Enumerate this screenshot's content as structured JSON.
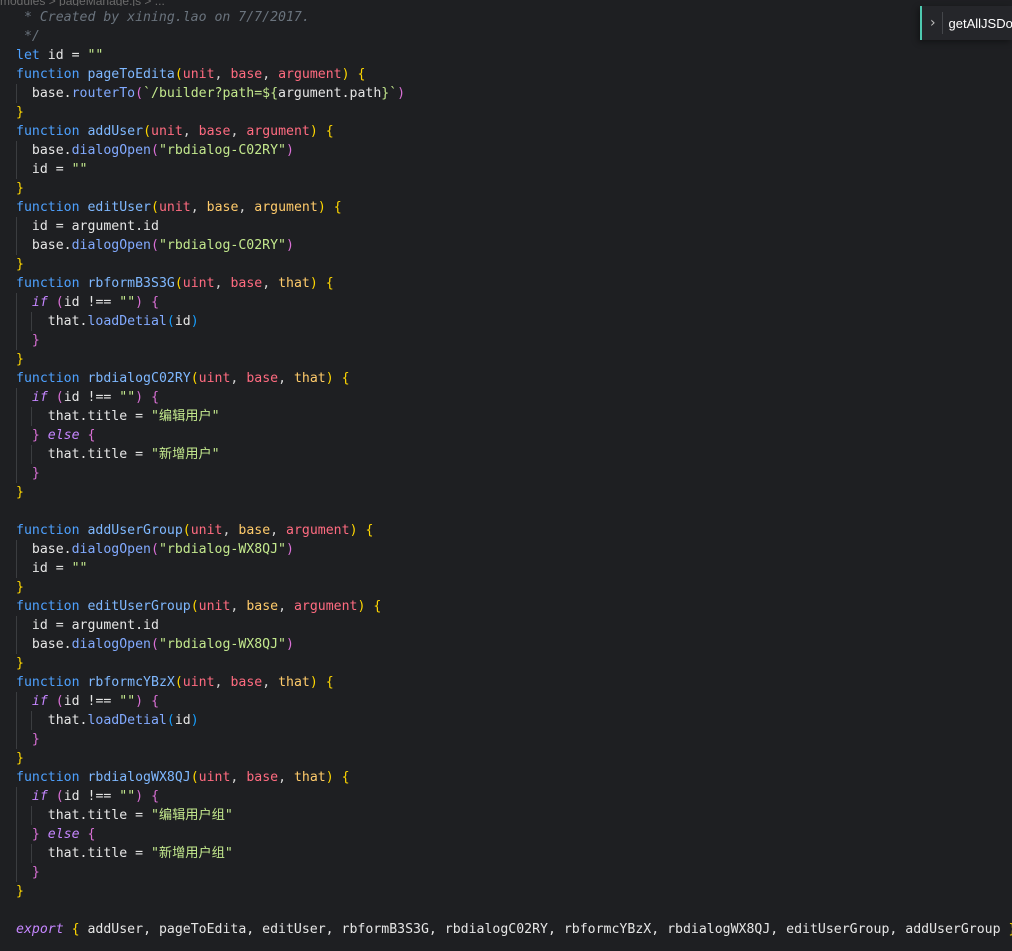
{
  "breadcrumb": {
    "text": "modules  >  pageManage.js  >  ..."
  },
  "outline": {
    "label": "getAllJSDoc"
  },
  "colors": {
    "background": "#1e1f22",
    "keyword": "#4ea1ff",
    "function_name": "#7fb8ff",
    "parameter": "#ff6b80",
    "string": "#c3e88d",
    "comment": "#6a737d",
    "control": "#c586ff"
  },
  "code": {
    "lines": [
      [
        {
          "t": " * Created by xining.lao on 7/7/2017.",
          "c": "comment"
        }
      ],
      [
        {
          "t": " */",
          "c": "comment"
        }
      ],
      [
        {
          "t": "let",
          "c": "keyword"
        },
        {
          "t": " id = ",
          "c": "var"
        },
        {
          "t": "\"\"",
          "c": "string"
        }
      ],
      [
        {
          "t": "function",
          "c": "keyword"
        },
        {
          "t": " ",
          "c": "var"
        },
        {
          "t": "pageToEdita",
          "c": "fn"
        },
        {
          "t": "(",
          "c": "b1"
        },
        {
          "t": "unit",
          "c": "param"
        },
        {
          "t": ", ",
          "c": "punc"
        },
        {
          "t": "base",
          "c": "param"
        },
        {
          "t": ", ",
          "c": "punc"
        },
        {
          "t": "argument",
          "c": "param"
        },
        {
          "t": ")",
          "c": "b1"
        },
        {
          "t": " ",
          "c": "punc"
        },
        {
          "t": "{",
          "c": "b1"
        }
      ],
      [
        {
          "t": "  base.",
          "c": "var"
        },
        {
          "t": "routerTo",
          "c": "method"
        },
        {
          "t": "(",
          "c": "b2"
        },
        {
          "t": "`/builder?path=${",
          "c": "string"
        },
        {
          "t": "argument.path",
          "c": "var"
        },
        {
          "t": "}`",
          "c": "string"
        },
        {
          "t": ")",
          "c": "b2"
        }
      ],
      [
        {
          "t": "}",
          "c": "b1"
        }
      ],
      [
        {
          "t": "function",
          "c": "keyword"
        },
        {
          "t": " ",
          "c": "var"
        },
        {
          "t": "addUser",
          "c": "fn"
        },
        {
          "t": "(",
          "c": "b1"
        },
        {
          "t": "unit",
          "c": "param"
        },
        {
          "t": ", ",
          "c": "punc"
        },
        {
          "t": "base",
          "c": "param"
        },
        {
          "t": ", ",
          "c": "punc"
        },
        {
          "t": "argument",
          "c": "param"
        },
        {
          "t": ")",
          "c": "b1"
        },
        {
          "t": " ",
          "c": "punc"
        },
        {
          "t": "{",
          "c": "b1"
        }
      ],
      [
        {
          "t": "  base.",
          "c": "var"
        },
        {
          "t": "dialogOpen",
          "c": "method"
        },
        {
          "t": "(",
          "c": "b2"
        },
        {
          "t": "\"rbdialog-C02RY\"",
          "c": "string"
        },
        {
          "t": ")",
          "c": "b2"
        }
      ],
      [
        {
          "t": "  id = ",
          "c": "var"
        },
        {
          "t": "\"\"",
          "c": "string"
        }
      ],
      [
        {
          "t": "}",
          "c": "b1"
        }
      ],
      [
        {
          "t": "function",
          "c": "keyword"
        },
        {
          "t": " ",
          "c": "var"
        },
        {
          "t": "editUser",
          "c": "fn"
        },
        {
          "t": "(",
          "c": "b1"
        },
        {
          "t": "unit",
          "c": "param"
        },
        {
          "t": ", ",
          "c": "punc"
        },
        {
          "t": "base",
          "c": "param-y"
        },
        {
          "t": ", ",
          "c": "punc"
        },
        {
          "t": "argument",
          "c": "param-y"
        },
        {
          "t": ")",
          "c": "b1"
        },
        {
          "t": " ",
          "c": "punc"
        },
        {
          "t": "{",
          "c": "b1"
        }
      ],
      [
        {
          "t": "  id = argument.id",
          "c": "var"
        }
      ],
      [
        {
          "t": "  base.",
          "c": "var"
        },
        {
          "t": "dialogOpen",
          "c": "method"
        },
        {
          "t": "(",
          "c": "b2"
        },
        {
          "t": "\"rbdialog-C02RY\"",
          "c": "string"
        },
        {
          "t": ")",
          "c": "b2"
        }
      ],
      [
        {
          "t": "}",
          "c": "b1"
        }
      ],
      [
        {
          "t": "function",
          "c": "keyword"
        },
        {
          "t": " ",
          "c": "var"
        },
        {
          "t": "rbformB3S3G",
          "c": "fn"
        },
        {
          "t": "(",
          "c": "b1"
        },
        {
          "t": "uint",
          "c": "param"
        },
        {
          "t": ", ",
          "c": "punc"
        },
        {
          "t": "base",
          "c": "param"
        },
        {
          "t": ", ",
          "c": "punc"
        },
        {
          "t": "that",
          "c": "param-y"
        },
        {
          "t": ")",
          "c": "b1"
        },
        {
          "t": " ",
          "c": "punc"
        },
        {
          "t": "{",
          "c": "b1"
        }
      ],
      [
        {
          "t": "  ",
          "c": "var"
        },
        {
          "t": "if",
          "c": "ctrl"
        },
        {
          "t": " ",
          "c": "var"
        },
        {
          "t": "(",
          "c": "b2"
        },
        {
          "t": "id !== ",
          "c": "var"
        },
        {
          "t": "\"\"",
          "c": "string"
        },
        {
          "t": ")",
          "c": "b2"
        },
        {
          "t": " ",
          "c": "var"
        },
        {
          "t": "{",
          "c": "b2"
        }
      ],
      [
        {
          "t": "    that.",
          "c": "var"
        },
        {
          "t": "loadDetial",
          "c": "method"
        },
        {
          "t": "(",
          "c": "b3"
        },
        {
          "t": "id",
          "c": "var"
        },
        {
          "t": ")",
          "c": "b3"
        }
      ],
      [
        {
          "t": "  ",
          "c": "var"
        },
        {
          "t": "}",
          "c": "b2"
        }
      ],
      [
        {
          "t": "}",
          "c": "b1"
        }
      ],
      [
        {
          "t": "function",
          "c": "keyword"
        },
        {
          "t": " ",
          "c": "var"
        },
        {
          "t": "rbdialogC02RY",
          "c": "fn"
        },
        {
          "t": "(",
          "c": "b1"
        },
        {
          "t": "uint",
          "c": "param"
        },
        {
          "t": ", ",
          "c": "punc"
        },
        {
          "t": "base",
          "c": "param"
        },
        {
          "t": ", ",
          "c": "punc"
        },
        {
          "t": "that",
          "c": "param-y"
        },
        {
          "t": ")",
          "c": "b1"
        },
        {
          "t": " ",
          "c": "punc"
        },
        {
          "t": "{",
          "c": "b1"
        }
      ],
      [
        {
          "t": "  ",
          "c": "var"
        },
        {
          "t": "if",
          "c": "ctrl"
        },
        {
          "t": " ",
          "c": "var"
        },
        {
          "t": "(",
          "c": "b2"
        },
        {
          "t": "id !== ",
          "c": "var"
        },
        {
          "t": "\"\"",
          "c": "string"
        },
        {
          "t": ")",
          "c": "b2"
        },
        {
          "t": " ",
          "c": "var"
        },
        {
          "t": "{",
          "c": "b2"
        }
      ],
      [
        {
          "t": "    that.title = ",
          "c": "var"
        },
        {
          "t": "\"编辑用户\"",
          "c": "string"
        }
      ],
      [
        {
          "t": "  ",
          "c": "var"
        },
        {
          "t": "}",
          "c": "b2"
        },
        {
          "t": " ",
          "c": "var"
        },
        {
          "t": "else",
          "c": "ctrl"
        },
        {
          "t": " ",
          "c": "var"
        },
        {
          "t": "{",
          "c": "b2"
        }
      ],
      [
        {
          "t": "    that.title = ",
          "c": "var"
        },
        {
          "t": "\"新增用户\"",
          "c": "string"
        }
      ],
      [
        {
          "t": "  ",
          "c": "var"
        },
        {
          "t": "}",
          "c": "b2"
        }
      ],
      [
        {
          "t": "}",
          "c": "b1"
        }
      ],
      [],
      [
        {
          "t": "function",
          "c": "keyword"
        },
        {
          "t": " ",
          "c": "var"
        },
        {
          "t": "addUserGroup",
          "c": "fn"
        },
        {
          "t": "(",
          "c": "b1"
        },
        {
          "t": "unit",
          "c": "param"
        },
        {
          "t": ", ",
          "c": "punc"
        },
        {
          "t": "base",
          "c": "param-y"
        },
        {
          "t": ", ",
          "c": "punc"
        },
        {
          "t": "argument",
          "c": "param"
        },
        {
          "t": ")",
          "c": "b1"
        },
        {
          "t": " ",
          "c": "punc"
        },
        {
          "t": "{",
          "c": "b1"
        }
      ],
      [
        {
          "t": "  base.",
          "c": "var"
        },
        {
          "t": "dialogOpen",
          "c": "method"
        },
        {
          "t": "(",
          "c": "b2"
        },
        {
          "t": "\"rbdialog-WX8QJ\"",
          "c": "string"
        },
        {
          "t": ")",
          "c": "b2"
        }
      ],
      [
        {
          "t": "  id = ",
          "c": "var"
        },
        {
          "t": "\"\"",
          "c": "string"
        }
      ],
      [
        {
          "t": "}",
          "c": "b1"
        }
      ],
      [
        {
          "t": "function",
          "c": "keyword"
        },
        {
          "t": " ",
          "c": "var"
        },
        {
          "t": "editUserGroup",
          "c": "fn"
        },
        {
          "t": "(",
          "c": "b1"
        },
        {
          "t": "unit",
          "c": "param"
        },
        {
          "t": ", ",
          "c": "punc"
        },
        {
          "t": "base",
          "c": "param-y"
        },
        {
          "t": ", ",
          "c": "punc"
        },
        {
          "t": "argument",
          "c": "param"
        },
        {
          "t": ")",
          "c": "b1"
        },
        {
          "t": " ",
          "c": "punc"
        },
        {
          "t": "{",
          "c": "b1"
        }
      ],
      [
        {
          "t": "  id = argument.id",
          "c": "var"
        }
      ],
      [
        {
          "t": "  base.",
          "c": "var"
        },
        {
          "t": "dialogOpen",
          "c": "method"
        },
        {
          "t": "(",
          "c": "b2"
        },
        {
          "t": "\"rbdialog-WX8QJ\"",
          "c": "string"
        },
        {
          "t": ")",
          "c": "b2"
        }
      ],
      [
        {
          "t": "}",
          "c": "b1"
        }
      ],
      [
        {
          "t": "function",
          "c": "keyword"
        },
        {
          "t": " ",
          "c": "var"
        },
        {
          "t": "rbformcYBzX",
          "c": "fn"
        },
        {
          "t": "(",
          "c": "b1"
        },
        {
          "t": "uint",
          "c": "param"
        },
        {
          "t": ", ",
          "c": "punc"
        },
        {
          "t": "base",
          "c": "param"
        },
        {
          "t": ", ",
          "c": "punc"
        },
        {
          "t": "that",
          "c": "param-y"
        },
        {
          "t": ")",
          "c": "b1"
        },
        {
          "t": " ",
          "c": "punc"
        },
        {
          "t": "{",
          "c": "b1"
        }
      ],
      [
        {
          "t": "  ",
          "c": "var"
        },
        {
          "t": "if",
          "c": "ctrl"
        },
        {
          "t": " ",
          "c": "var"
        },
        {
          "t": "(",
          "c": "b2"
        },
        {
          "t": "id !== ",
          "c": "var"
        },
        {
          "t": "\"\"",
          "c": "string"
        },
        {
          "t": ")",
          "c": "b2"
        },
        {
          "t": " ",
          "c": "var"
        },
        {
          "t": "{",
          "c": "b2"
        }
      ],
      [
        {
          "t": "    that.",
          "c": "var"
        },
        {
          "t": "loadDetial",
          "c": "method"
        },
        {
          "t": "(",
          "c": "b3"
        },
        {
          "t": "id",
          "c": "var"
        },
        {
          "t": ")",
          "c": "b3"
        }
      ],
      [
        {
          "t": "  ",
          "c": "var"
        },
        {
          "t": "}",
          "c": "b2"
        }
      ],
      [
        {
          "t": "}",
          "c": "b1"
        }
      ],
      [
        {
          "t": "function",
          "c": "keyword"
        },
        {
          "t": " ",
          "c": "var"
        },
        {
          "t": "rbdialogWX8QJ",
          "c": "fn"
        },
        {
          "t": "(",
          "c": "b1"
        },
        {
          "t": "uint",
          "c": "param"
        },
        {
          "t": ", ",
          "c": "punc"
        },
        {
          "t": "base",
          "c": "param"
        },
        {
          "t": ", ",
          "c": "punc"
        },
        {
          "t": "that",
          "c": "param-y"
        },
        {
          "t": ")",
          "c": "b1"
        },
        {
          "t": " ",
          "c": "punc"
        },
        {
          "t": "{",
          "c": "b1"
        }
      ],
      [
        {
          "t": "  ",
          "c": "var"
        },
        {
          "t": "if",
          "c": "ctrl"
        },
        {
          "t": " ",
          "c": "var"
        },
        {
          "t": "(",
          "c": "b2"
        },
        {
          "t": "id !== ",
          "c": "var"
        },
        {
          "t": "\"\"",
          "c": "string"
        },
        {
          "t": ")",
          "c": "b2"
        },
        {
          "t": " ",
          "c": "var"
        },
        {
          "t": "{",
          "c": "b2"
        }
      ],
      [
        {
          "t": "    that.title = ",
          "c": "var"
        },
        {
          "t": "\"编辑用户组\"",
          "c": "string"
        }
      ],
      [
        {
          "t": "  ",
          "c": "var"
        },
        {
          "t": "}",
          "c": "b2"
        },
        {
          "t": " ",
          "c": "var"
        },
        {
          "t": "else",
          "c": "ctrl"
        },
        {
          "t": " ",
          "c": "var"
        },
        {
          "t": "{",
          "c": "b2"
        }
      ],
      [
        {
          "t": "    that.title = ",
          "c": "var"
        },
        {
          "t": "\"新增用户组\"",
          "c": "string"
        }
      ],
      [
        {
          "t": "  ",
          "c": "var"
        },
        {
          "t": "}",
          "c": "b2"
        }
      ],
      [
        {
          "t": "}",
          "c": "b1"
        }
      ],
      [],
      [
        {
          "t": "export",
          "c": "ctrl"
        },
        {
          "t": " ",
          "c": "var"
        },
        {
          "t": "{",
          "c": "b1"
        },
        {
          "t": " addUser, pageToEdita, editUser, rbformB3S3G, rbdialogC02RY, rbformcYBzX, rbdialogWX8QJ, editUserGroup, addUserGroup ",
          "c": "var"
        },
        {
          "t": "}",
          "c": "b1"
        }
      ]
    ]
  }
}
